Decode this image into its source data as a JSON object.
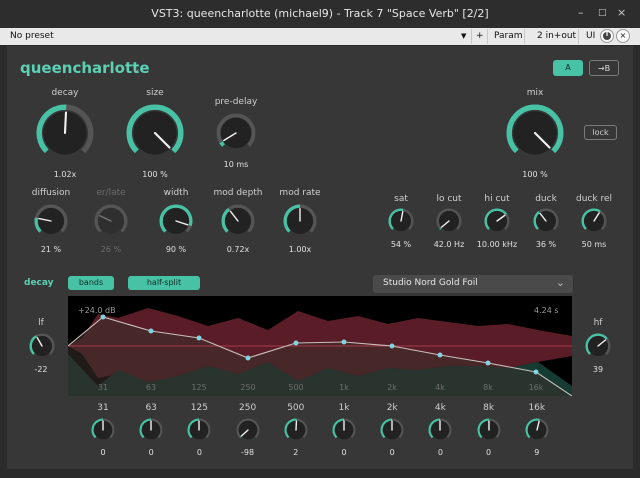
{
  "window": {
    "title": "VST3: queencharlotte (michael9) - Track 7 \"Space Verb\" [2/2]",
    "minimize": "–",
    "maximize": "□",
    "close": "×"
  },
  "host": {
    "preset": "No preset",
    "dropdown_arrow": "▼",
    "plus": "+",
    "param": "Param",
    "io": "2 in+out",
    "ui": "UI",
    "close": "×"
  },
  "plugin": {
    "name": "queencharlotte",
    "caret": "⌄",
    "a_label": "A",
    "b_label": "→B",
    "lock_label": "lock"
  },
  "colors": {
    "accent": "#48c2a5",
    "panel": "#373737",
    "red_band": "#5a1d27",
    "teal_band": "#163b33"
  },
  "knobs_row1": [
    {
      "id": "decay",
      "label": "decay",
      "value": "1.02x",
      "level": 0.51
    },
    {
      "id": "size",
      "label": "size",
      "value": "100 %",
      "level": 1.0
    },
    {
      "id": "pre-delay",
      "label": "pre-delay",
      "value": "10 ms",
      "level": 0.05
    },
    {
      "id": "mix",
      "label": "mix",
      "value": "100 %",
      "level": 1.0
    }
  ],
  "knobs_row2": [
    {
      "id": "diffusion",
      "label": "diffusion",
      "value": "21 %",
      "level": 0.21
    },
    {
      "id": "er-late",
      "label": "er/late",
      "value": "26 %",
      "level": 0.26,
      "disabled": true
    },
    {
      "id": "width",
      "label": "width",
      "value": "90 %",
      "level": 0.9
    },
    {
      "id": "mod-depth",
      "label": "mod depth",
      "value": "0.72x",
      "level": 0.36
    },
    {
      "id": "mod-rate",
      "label": "mod rate",
      "value": "1.00x",
      "level": 0.5
    },
    {
      "id": "sat",
      "label": "sat",
      "value": "54 %",
      "level": 0.54
    },
    {
      "id": "lo-cut",
      "label": "lo cut",
      "value": "42.0 Hz",
      "level": 0.02
    },
    {
      "id": "hi-cut",
      "label": "hi cut",
      "value": "10.00 kHz",
      "level": 0.7
    },
    {
      "id": "duck",
      "label": "duck",
      "value": "36 %",
      "level": 0.36
    },
    {
      "id": "duck-rel",
      "label": "duck rel",
      "value": "50 ms",
      "level": 0.62
    }
  ],
  "eq": {
    "section_label": "decay",
    "bands_button": "bands",
    "half_split_button": "half-split",
    "preset_name": "Studio Nord Gold Foil",
    "preset_arrow": "⌄",
    "top_left": "+24.0 dB",
    "top_right": "4.24 s",
    "lf": {
      "label": "lf",
      "value": "-22",
      "level": 0.39
    },
    "hf": {
      "label": "hf",
      "value": "39",
      "level": 0.69
    },
    "bands": [
      {
        "freq": "31",
        "value": "0",
        "level": 0.5
      },
      {
        "freq": "63",
        "value": "0",
        "level": 0.5
      },
      {
        "freq": "125",
        "value": "0",
        "level": 0.5
      },
      {
        "freq": "250",
        "value": "-98",
        "level": 0.01
      },
      {
        "freq": "500",
        "value": "2",
        "level": 0.51
      },
      {
        "freq": "1k",
        "value": "0",
        "level": 0.5
      },
      {
        "freq": "2k",
        "value": "0",
        "level": 0.5
      },
      {
        "freq": "4k",
        "value": "0",
        "level": 0.5
      },
      {
        "freq": "8k",
        "value": "0",
        "level": 0.5
      },
      {
        "freq": "16k",
        "value": "9",
        "level": 0.55
      }
    ]
  }
}
